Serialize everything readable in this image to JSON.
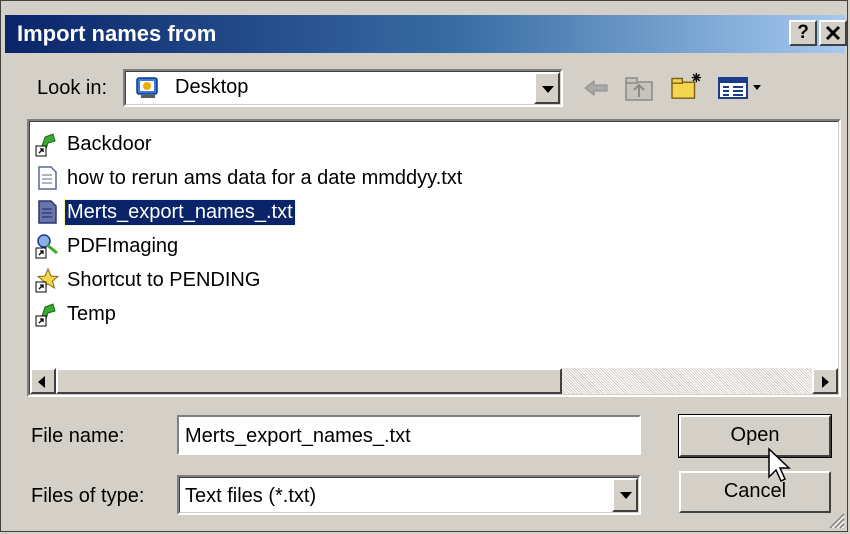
{
  "window": {
    "title": "Import names from",
    "help_label": "?",
    "close_label": "✕"
  },
  "toolbar": {
    "look_in_label": "Look in:",
    "look_in_value": "Desktop",
    "icons": [
      "back-arrow-icon",
      "up-folder-icon",
      "new-folder-icon",
      "view-menu-icon"
    ]
  },
  "files": [
    {
      "name": "Backdoor",
      "icon": "shortcut-green-icon",
      "selected": false
    },
    {
      "name": "how to rerun ams data for a date mmddyy.txt",
      "icon": "text-file-icon",
      "selected": false
    },
    {
      "name": "Merts_export_names_.txt",
      "icon": "text-file-icon",
      "selected": true
    },
    {
      "name": "PDFImaging",
      "icon": "shortcut-imaging-icon",
      "selected": false
    },
    {
      "name": "Shortcut to PENDING",
      "icon": "shortcut-star-icon",
      "selected": false
    },
    {
      "name": "Temp",
      "icon": "shortcut-green-icon",
      "selected": false
    }
  ],
  "form": {
    "file_name_label": "File name:",
    "file_name_value": "Merts_export_names_.txt",
    "file_type_label": "Files of type:",
    "file_type_value": "Text files (*.txt)"
  },
  "buttons": {
    "open_label": "Open",
    "cancel_label": "Cancel"
  }
}
